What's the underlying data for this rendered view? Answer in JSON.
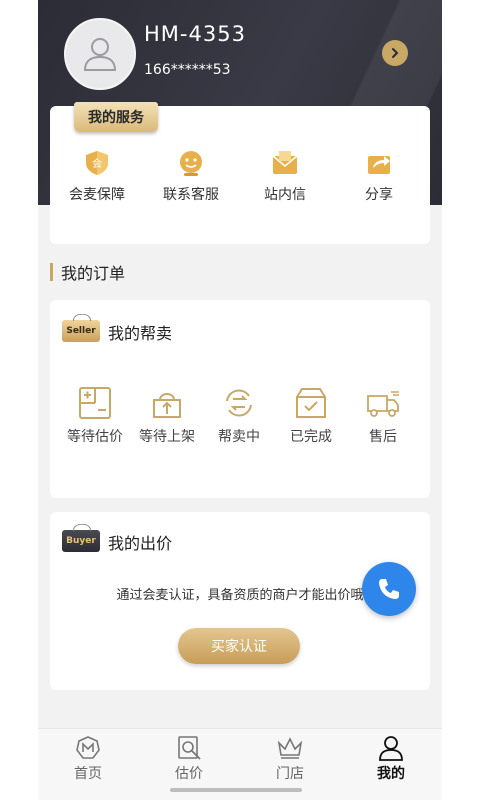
{
  "profile": {
    "username": "HM-4353",
    "phone": "166******53"
  },
  "services": {
    "tag": "我的服务",
    "items": [
      {
        "label": "会麦保障",
        "icon": "shield-icon"
      },
      {
        "label": "联系客服",
        "icon": "customer-service-icon"
      },
      {
        "label": "站内信",
        "icon": "inbox-icon"
      },
      {
        "label": "分享",
        "icon": "share-icon"
      }
    ]
  },
  "orders": {
    "section_title": "我的订单",
    "help_sell": {
      "badge": "Seller",
      "title": "我的帮卖",
      "items": [
        {
          "label": "等待估价",
          "icon": "estimate-icon"
        },
        {
          "label": "等待上架",
          "icon": "shelf-upload-icon"
        },
        {
          "label": "帮卖中",
          "icon": "exchange-icon"
        },
        {
          "label": "已完成",
          "icon": "box-check-icon"
        },
        {
          "label": "售后",
          "icon": "truck-icon"
        }
      ]
    },
    "bids": {
      "badge": "Buyer",
      "title": "我的出价",
      "message": "通过会麦认证，具备资质的商户才能出价哦",
      "button": "买家认证"
    }
  },
  "tabbar": {
    "items": [
      {
        "label": "首页",
        "icon": "home-m-icon"
      },
      {
        "label": "估价",
        "icon": "appraise-icon"
      },
      {
        "label": "门店",
        "icon": "crown-icon"
      },
      {
        "label": "我的",
        "icon": "user-icon"
      }
    ],
    "active": "我的"
  },
  "colors": {
    "accent_gold": "#c9a866",
    "header_dark": "#2c2c36",
    "call_blue": "#2f86ea"
  }
}
